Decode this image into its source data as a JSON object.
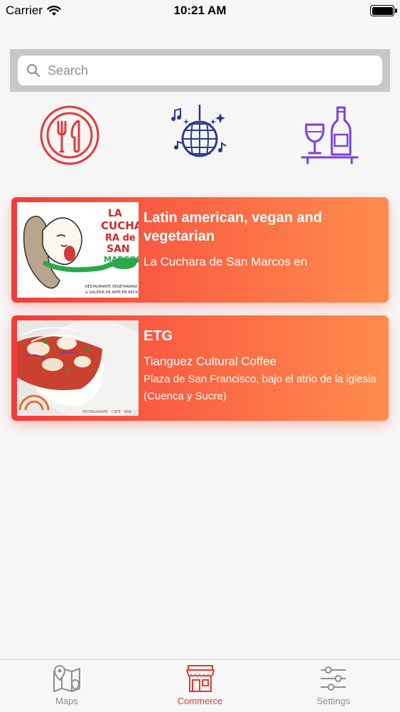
{
  "status": {
    "carrier": "Carrier",
    "time": "10:21 AM"
  },
  "search": {
    "placeholder": "Search",
    "value": ""
  },
  "categories": [
    {
      "icon": "restaurant-plate-icon",
      "color": "#e53935"
    },
    {
      "icon": "disco-ball-icon",
      "color": "#2b3a8c"
    },
    {
      "icon": "wine-bottle-icon",
      "color": "#7b3fe4"
    }
  ],
  "places": [
    {
      "title": "Latin american, vegan and vegetarian",
      "subtitle": "La Cuchara de San Marcos en",
      "address": "",
      "logo_text": [
        "LA",
        "CUCHA",
        "RA",
        "de",
        "SAN",
        "MARCOS"
      ],
      "logo_caption": "RESTAURANTE VEGETARIANO & GALERIA DE ARTE EN RECICLAJE"
    },
    {
      "title": "ETG",
      "subtitle": "Tianguez Cultural Coffee",
      "address": "Plaza de San Francisco, bajo el atrio de la iglesia (Cuenca y Sucre)",
      "logo_caption": "RESTAURANTE · CAFÉ · BAR"
    }
  ],
  "tabs": [
    {
      "label": "Maps",
      "icon": "map-pin-icon",
      "active": false
    },
    {
      "label": "Commerce",
      "icon": "storefront-icon",
      "active": true
    },
    {
      "label": "Settings",
      "icon": "sliders-icon",
      "active": false
    }
  ],
  "colors": {
    "accent": "#e53935",
    "card_gradient_start": "#f43b3b",
    "card_gradient_end": "#ff8c4e"
  }
}
